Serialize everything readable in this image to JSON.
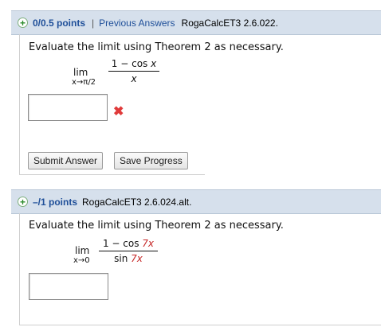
{
  "q1": {
    "points": "0/0.5 points",
    "separator": "|",
    "previous_answers": "Previous Answers",
    "code": "RogaCalcET3 2.6.022.",
    "prompt": "Evaluate the limit using Theorem 2 as necessary.",
    "lim": "lim",
    "limit_sub": "x→π/2",
    "numerator": "1 − cos x",
    "denominator": "x",
    "answer_value": "",
    "status_icon": "x-mark-icon",
    "submit_label": "Submit Answer",
    "save_label": "Save Progress"
  },
  "q2": {
    "points": "–/1 points",
    "code": "RogaCalcET3 2.6.024.alt.",
    "prompt": "Evaluate the limit using Theorem 2 as necessary.",
    "lim": "lim",
    "limit_sub": "x→0",
    "num_pre": "1 − cos ",
    "num_red": "7x",
    "den_pre": "sin ",
    "den_red": "7x",
    "answer_value": ""
  },
  "colors": {
    "header_bg": "#d6e0ec",
    "link": "#1f4f99",
    "error": "#e03a3a",
    "highlight": "#c62828"
  }
}
